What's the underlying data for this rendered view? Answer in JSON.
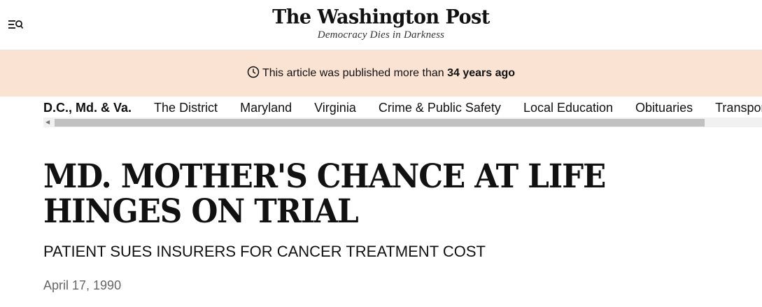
{
  "header": {
    "menu_icon": "menu-search-icon",
    "logo_text": "The Washington Post",
    "tagline": "Democracy Dies in Darkness"
  },
  "banner": {
    "icon": "clock-icon",
    "text": "This article was published more than",
    "highlight": "34 years ago",
    "background": "#fbe3d4"
  },
  "nav": {
    "items": [
      {
        "label": "D.C., Md. & Va.",
        "active": true
      },
      {
        "label": "The District"
      },
      {
        "label": "Maryland"
      },
      {
        "label": "Virginia"
      },
      {
        "label": "Crime & Public Safety"
      },
      {
        "label": "Local Education"
      },
      {
        "label": "Obituaries"
      },
      {
        "label": "Transportation"
      }
    ]
  },
  "article": {
    "headline": "MD. MOTHER'S CHANCE AT LIFE HINGES ON TRIAL",
    "subheadline": "PATIENT SUES INSURERS FOR CANCER TREATMENT COST",
    "date": "April 17, 1990"
  }
}
